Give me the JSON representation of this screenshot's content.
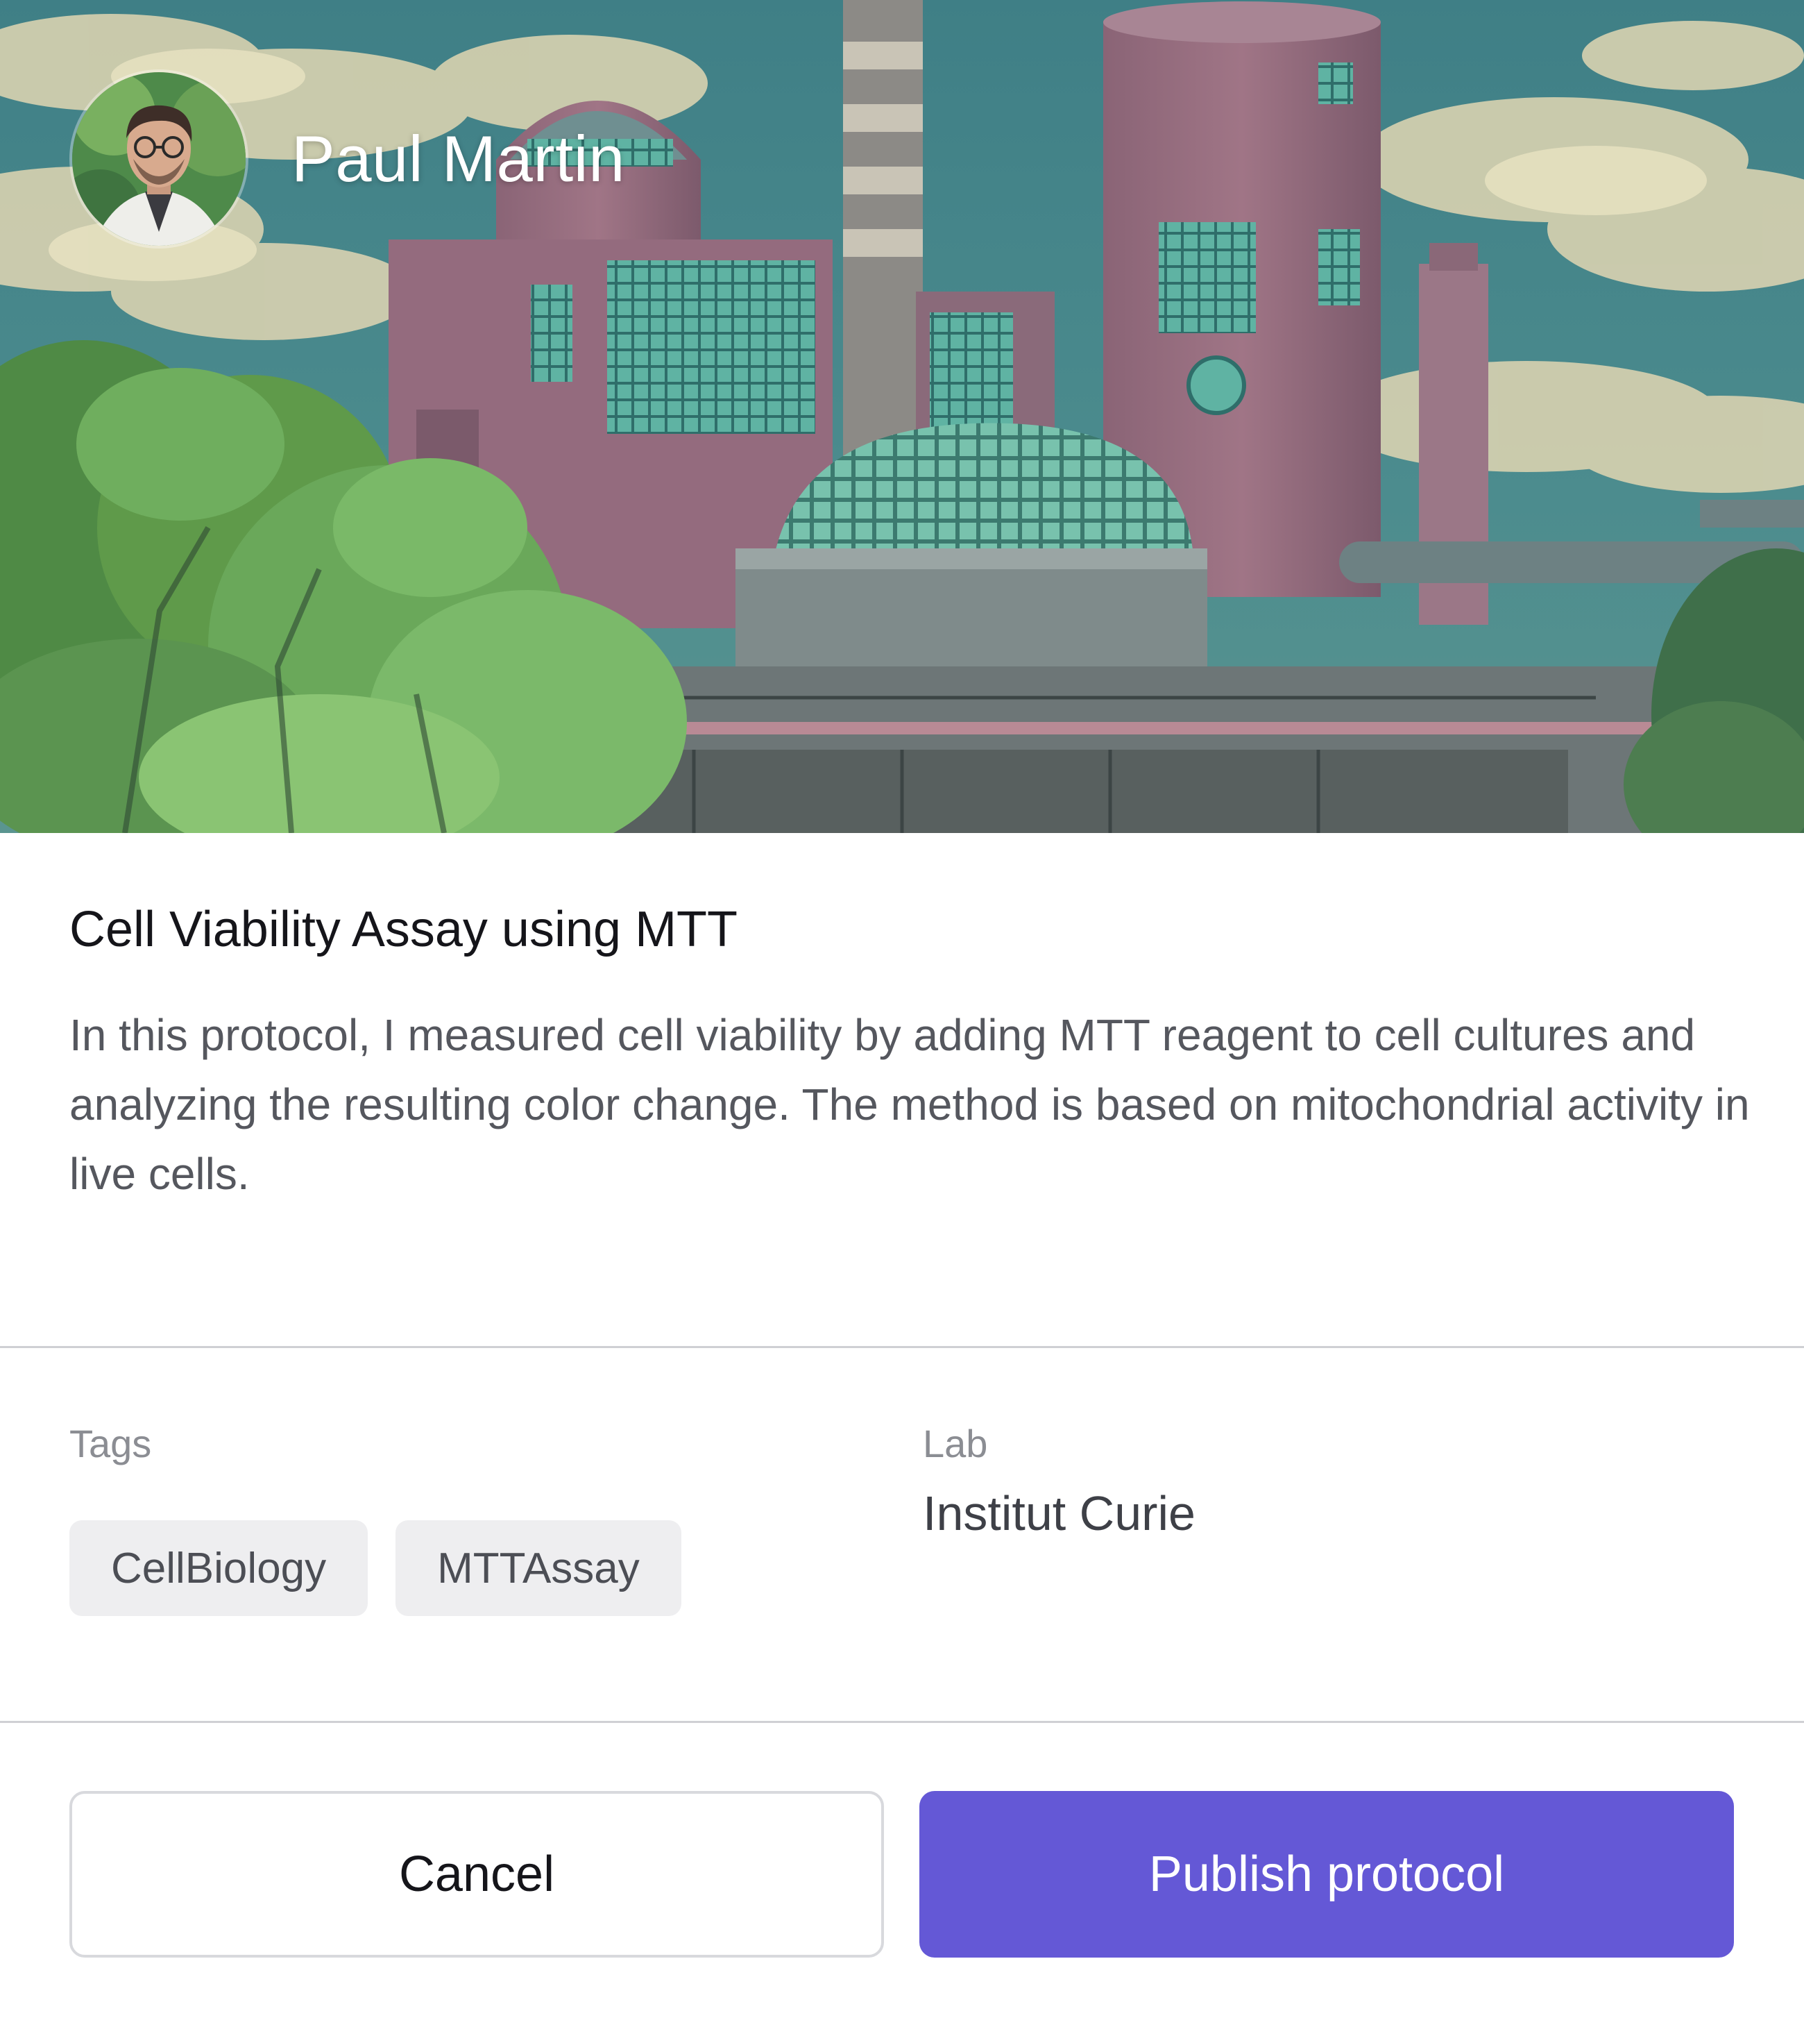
{
  "author": {
    "name": "Paul Martin"
  },
  "protocol": {
    "title": "Cell Viability Assay using MTT",
    "description": "In this protocol, I measured cell viability by adding MTT reagent to cell cultures and analyzing the resulting color change. The method is based on mitochondrial activity in live cells."
  },
  "meta": {
    "tags_label": "Tags",
    "tags": [
      "CellBiology",
      "MTTAssay"
    ],
    "lab_label": "Lab",
    "lab_value": "Institut Curie"
  },
  "actions": {
    "cancel_label": "Cancel",
    "publish_label": "Publish protocol"
  },
  "colors": {
    "primary_button": "#6458d6",
    "tag_background": "#eeeef0"
  }
}
